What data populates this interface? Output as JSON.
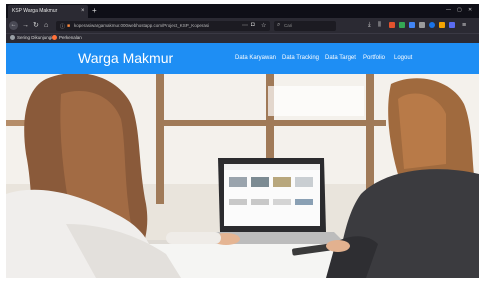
{
  "browser": {
    "tab_title": "KSP Warga Makmur",
    "tab_close": "×",
    "new_tab": "+",
    "url": "koperasiwargamakmur.000webhostapp.com/Project_KSP_Koperasi",
    "search_placeholder": "Cari",
    "bookmarks": [
      {
        "label": "Sering Dikunjungi",
        "color": "#9aa0a6"
      },
      {
        "label": "Perkenalan",
        "color": "#ff7139"
      }
    ]
  },
  "site": {
    "brand": "Warga Makmur",
    "header_color": "#1e8ef4",
    "menu": [
      {
        "label": "Data Karyawan"
      },
      {
        "label": "Data Tracking"
      },
      {
        "label": "Data Target"
      },
      {
        "label": "Portfolio"
      },
      {
        "label": "Logout"
      }
    ]
  },
  "hero": {
    "image": "two-women-looking-at-laptop"
  }
}
